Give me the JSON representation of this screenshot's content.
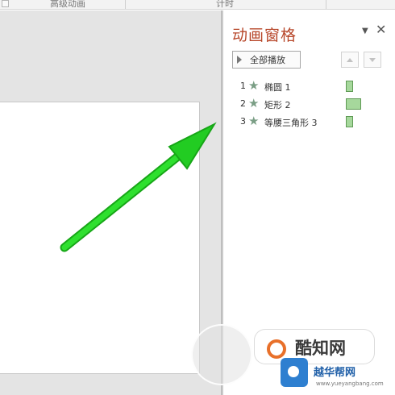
{
  "ribbon": {
    "group_advanced": "高级动画",
    "group_timing": "计时"
  },
  "pane": {
    "title": "动画窗格",
    "menu_glyph": "▼",
    "close_glyph": "✕",
    "play_all_label": "全部播放",
    "items": [
      {
        "number": "1",
        "label": "椭圆 1",
        "bar_fraction": 0.33
      },
      {
        "number": "2",
        "label": "矩形 2",
        "bar_fraction": 1.0
      },
      {
        "number": "3",
        "label": "等腰三角形 3",
        "bar_fraction": 0.33
      }
    ]
  },
  "watermark": {
    "brand_cn": "酷知网",
    "brand_secondary": "越华帮网",
    "site_url": "www.yueyangbang.com"
  },
  "colors": {
    "pane_title": "#b7472a",
    "arrow": "#22cc22",
    "timeline_bar": "#a6d89c"
  },
  "icons": [
    "star-icon",
    "play-triangle-icon",
    "chevron-up-icon",
    "chevron-down-icon",
    "close-icon",
    "dropdown-icon"
  ]
}
